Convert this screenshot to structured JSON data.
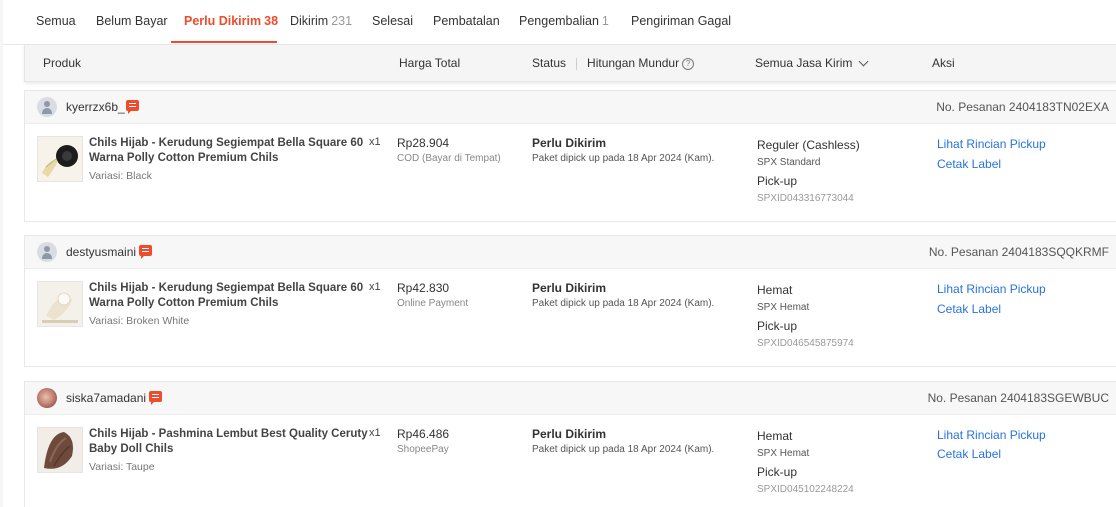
{
  "tabs": [
    {
      "label": "Semua",
      "count": ""
    },
    {
      "label": "Belum Bayar",
      "count": ""
    },
    {
      "label": "Perlu Dikirim",
      "count": "38"
    },
    {
      "label": "Dikirim",
      "count": "231"
    },
    {
      "label": "Selesai",
      "count": ""
    },
    {
      "label": "Pembatalan",
      "count": ""
    },
    {
      "label": "Pengembalian",
      "count": "1"
    },
    {
      "label": "Pengiriman Gagal",
      "count": ""
    }
  ],
  "active_tab": "Perlu Dikirim",
  "accent_color": "#ee4d2d",
  "link_color": "#2673dd",
  "table_header": {
    "produk": "Produk",
    "harga": "Harga Total",
    "status": "Status",
    "countdown": "Hitungan Mundur",
    "jasa_kirim": "Semua Jasa Kirim",
    "aksi": "Aksi"
  },
  "orders": [
    {
      "username": "kyerrzx6b_",
      "avatar": "default-user-icon",
      "order_no": "No. Pesanan 2404183TN02EXA",
      "product_name": "Chils Hijab - Kerudung Segiempat Bella Square 60 Warna Polly Cotton Premium Chils",
      "qty": "x1",
      "variant": "Variasi: Black",
      "price": "Rp28.904",
      "payment": "COD (Bayar di Tempat)",
      "status": "Perlu Dikirim",
      "status_detail": "Paket dipick up pada 18 Apr 2024 (Kam).",
      "ship_type": "Reguler (Cashless)",
      "ship_service": "SPX Standard",
      "ship_method": "Pick-up",
      "tracking": "SPXID043316773044",
      "action_1": "Lihat Rincian Pickup",
      "action_2": "Cetak Label"
    },
    {
      "username": "destyusmaini",
      "avatar": "default-user-icon",
      "order_no": "No. Pesanan 2404183SQQKRMF",
      "product_name": "Chils Hijab - Kerudung Segiempat Bella Square 60 Warna Polly Cotton Premium Chils",
      "qty": "x1",
      "variant": "Variasi: Broken White",
      "price": "Rp42.830",
      "payment": "Online Payment",
      "status": "Perlu Dikirim",
      "status_detail": "Paket dipick up pada 18 Apr 2024 (Kam).",
      "ship_type": "Hemat",
      "ship_service": "SPX Hemat",
      "ship_method": "Pick-up",
      "tracking": "SPXID046545875974",
      "action_1": "Lihat Rincian Pickup",
      "action_2": "Cetak Label"
    },
    {
      "username": "siska7amadani",
      "avatar": "photo-avatar",
      "order_no": "No. Pesanan 2404183SGEWBUC",
      "product_name": "Chils Hijab - Pashmina Lembut Best Quality Ceruty Baby Doll Chils",
      "qty": "x1",
      "variant": "Variasi: Taupe",
      "price": "Rp46.486",
      "payment": "ShopeePay",
      "status": "Perlu Dikirim",
      "status_detail": "Paket dipick up pada 18 Apr 2024 (Kam).",
      "ship_type": "Hemat",
      "ship_service": "SPX Hemat",
      "ship_method": "Pick-up",
      "tracking": "SPXID045102248224",
      "action_1": "Lihat Rincian Pickup",
      "action_2": "Cetak Label"
    }
  ]
}
